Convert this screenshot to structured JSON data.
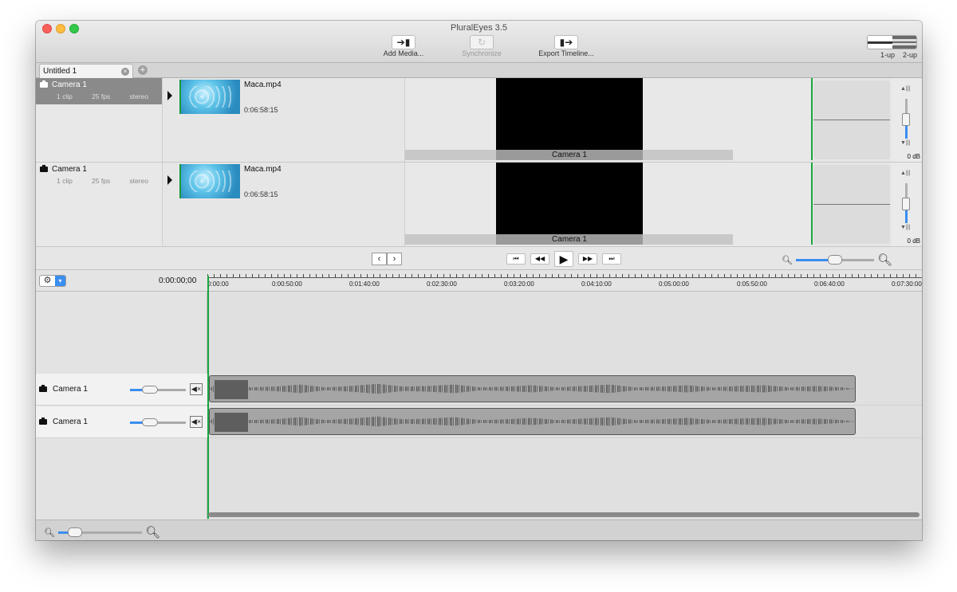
{
  "window": {
    "title": "PluralEyes 3.5"
  },
  "toolbar": {
    "add_media": {
      "label": "Add Media...",
      "icon": "import-arrow-icon"
    },
    "synchronize": {
      "label": "Synchronize",
      "icon": "sync-icon",
      "enabled": false
    },
    "export_timeline": {
      "label": "Export Timeline...",
      "icon": "export-arrow-icon"
    },
    "view_1up": "1-up",
    "view_2up": "2-up",
    "selected_view": "2-up"
  },
  "tabs": [
    {
      "label": "Untitled 1"
    }
  ],
  "clips": [
    {
      "camera": "Camera 1",
      "clips": "1 clip",
      "fps": "25 fps",
      "audio": "stereo",
      "file": "Maca.mp4",
      "duration": "0:06:58:15",
      "preview_label": "Camera 1",
      "volume": "0 dB",
      "selected": true
    },
    {
      "camera": "Camera 1",
      "clips": "1 clip",
      "fps": "25 fps",
      "audio": "stereo",
      "file": "Maca.mp4",
      "duration": "0:06:58:15",
      "preview_label": "Camera 1",
      "volume": "0 dB",
      "selected": false
    }
  ],
  "transport": {
    "prev_clip": "⏮",
    "rewind": "◀◀",
    "play": "▶",
    "forward": "▶▶",
    "next_clip": "⏭",
    "preview_zoom_level": 0.5
  },
  "timeline": {
    "timecode": "0:00:00;00",
    "ruler_labels": [
      "0:00:00",
      "0:00:50:00",
      "0:01:40:00",
      "0:02:30:00",
      "0:03:20:00",
      "0:04:10:00",
      "0:05:00:00",
      "0:05:50:00",
      "0:06:40:00",
      "0:07:30:00"
    ],
    "tracks": [
      {
        "name": "Camera 1",
        "volume_level": 0.25
      },
      {
        "name": "Camera 1",
        "volume_level": 0.25
      }
    ],
    "zoom_level": 0.15
  },
  "colors": {
    "accent": "#3a8ef0",
    "playhead": "#1aa63c"
  }
}
